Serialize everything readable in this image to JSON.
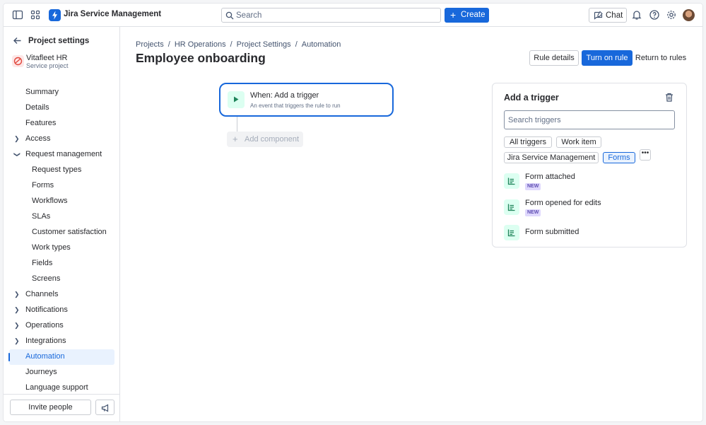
{
  "topbar": {
    "product_name": "Jira Service Management",
    "search_placeholder": "Search",
    "create_label": "Create",
    "chat_label": "Chat"
  },
  "sidebar": {
    "title": "Project settings",
    "project_name": "Vitafleet HR",
    "project_type": "Service project",
    "items": [
      {
        "label": "Summary"
      },
      {
        "label": "Details"
      },
      {
        "label": "Features"
      },
      {
        "label": "Access"
      },
      {
        "label": "Request management"
      },
      {
        "label": "Request types"
      },
      {
        "label": "Forms"
      },
      {
        "label": "Workflows"
      },
      {
        "label": "SLAs"
      },
      {
        "label": "Customer satisfaction"
      },
      {
        "label": "Work types"
      },
      {
        "label": "Fields"
      },
      {
        "label": "Screens"
      },
      {
        "label": "Channels"
      },
      {
        "label": "Notifications"
      },
      {
        "label": "Operations"
      },
      {
        "label": "Integrations"
      },
      {
        "label": "Automation"
      },
      {
        "label": "Journeys"
      },
      {
        "label": "Language support"
      }
    ],
    "invite_label": "Invite people"
  },
  "breadcrumbs": [
    "Projects",
    "HR Operations",
    "Project Settings",
    "Automation"
  ],
  "page_title": "Employee onboarding",
  "actions": {
    "rule_details": "Rule details",
    "turn_on": "Turn on rule",
    "return": "Return to rules"
  },
  "canvas": {
    "trigger_title": "When: Add a trigger",
    "trigger_sub": "An event that triggers the rule to run",
    "add_component": "Add component"
  },
  "panel": {
    "title": "Add a trigger",
    "search_placeholder": "Search triggers",
    "chips": [
      "All triggers",
      "Work item",
      "Jira Service Management",
      "Forms"
    ],
    "selected_chip": "Forms",
    "items": [
      {
        "name": "Form attached",
        "badge": "NEW"
      },
      {
        "name": "Form opened for edits",
        "badge": "NEW"
      },
      {
        "name": "Form submitted",
        "badge": ""
      }
    ]
  },
  "colors": {
    "accent": "#1868db",
    "trigger_icon_bg": "#dcfff1",
    "badge_bg": "#dfd8fd"
  }
}
